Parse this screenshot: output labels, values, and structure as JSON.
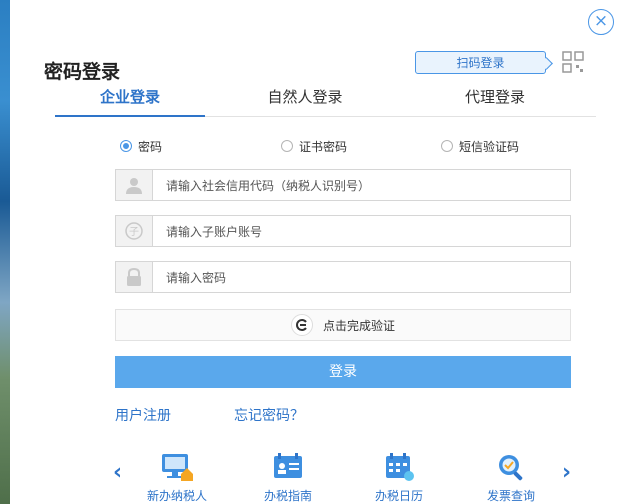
{
  "dialog": {
    "title": "密码登录",
    "qr_login_label": "扫码登录",
    "close_icon": "close-icon"
  },
  "tabs": [
    {
      "label": "企业登录",
      "active": true
    },
    {
      "label": "自然人登录",
      "active": false
    },
    {
      "label": "代理登录",
      "active": false
    }
  ],
  "login_methods": [
    {
      "label": "密码",
      "selected": true
    },
    {
      "label": "证书密码",
      "selected": false
    },
    {
      "label": "短信验证码",
      "selected": false
    }
  ],
  "fields": {
    "credit_code_placeholder": "请输入社会信用代码（纳税人识别号）",
    "sub_account_placeholder": "请输入子账户账号",
    "password_placeholder": "请输入密码"
  },
  "verify": {
    "label": "点击完成验证"
  },
  "login_button": "登录",
  "links": {
    "register": "用户注册",
    "forgot": "忘记密码？"
  },
  "services": [
    {
      "label": "新办纳税人",
      "icon": "new-taxpayer-icon"
    },
    {
      "label": "办税指南",
      "icon": "guide-icon"
    },
    {
      "label": "办税日历",
      "icon": "calendar-icon"
    },
    {
      "label": "发票查询",
      "icon": "invoice-search-icon"
    }
  ],
  "nav": {
    "prev": "‹",
    "next": "›"
  },
  "colors": {
    "accent": "#2e74c9",
    "button": "#5aa8ec"
  }
}
